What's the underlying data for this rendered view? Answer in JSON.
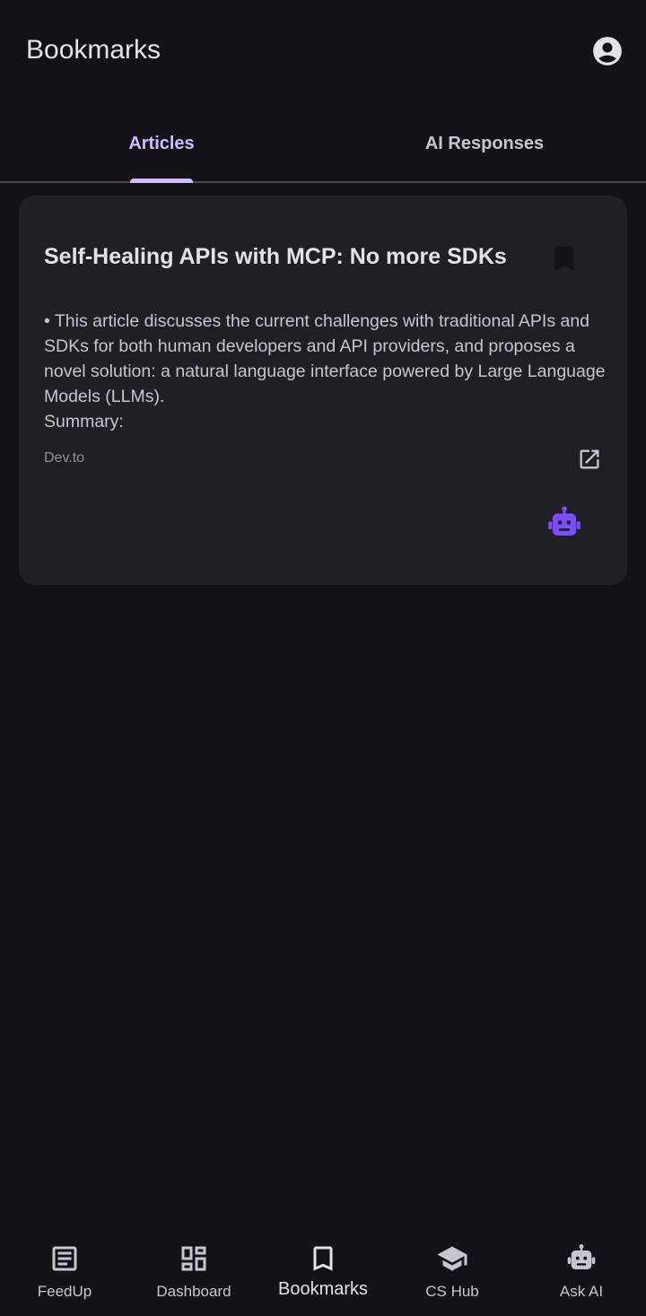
{
  "header": {
    "title": "Bookmarks",
    "account_icon": "account-circle-icon"
  },
  "tabs": [
    {
      "label": "Articles",
      "selected": true
    },
    {
      "label": "AI Responses",
      "selected": false
    }
  ],
  "article": {
    "title": "Self-Healing APIs with MCP: No more SDKs",
    "body": "• This article discusses the current challenges with traditional APIs and SDKs for both human developers and API providers, and proposes a novel solution: a natural language interface powered by Large Language Models (LLMs).\nSummary:",
    "source": "Dev.to",
    "bookmarked": true
  },
  "bottom_nav": [
    {
      "label": "FeedUp",
      "icon": "article-icon"
    },
    {
      "label": "Dashboard",
      "icon": "dashboard-icon"
    },
    {
      "label": "Bookmarks",
      "icon": "bookmark-icon",
      "active": true
    },
    {
      "label": "CS Hub",
      "icon": "school-icon"
    },
    {
      "label": "Ask AI",
      "icon": "robot-icon"
    }
  ],
  "colors": {
    "background": "#141218",
    "card": "#211f26",
    "accent": "#d0bcff",
    "ai_button": "#7c4dff"
  }
}
